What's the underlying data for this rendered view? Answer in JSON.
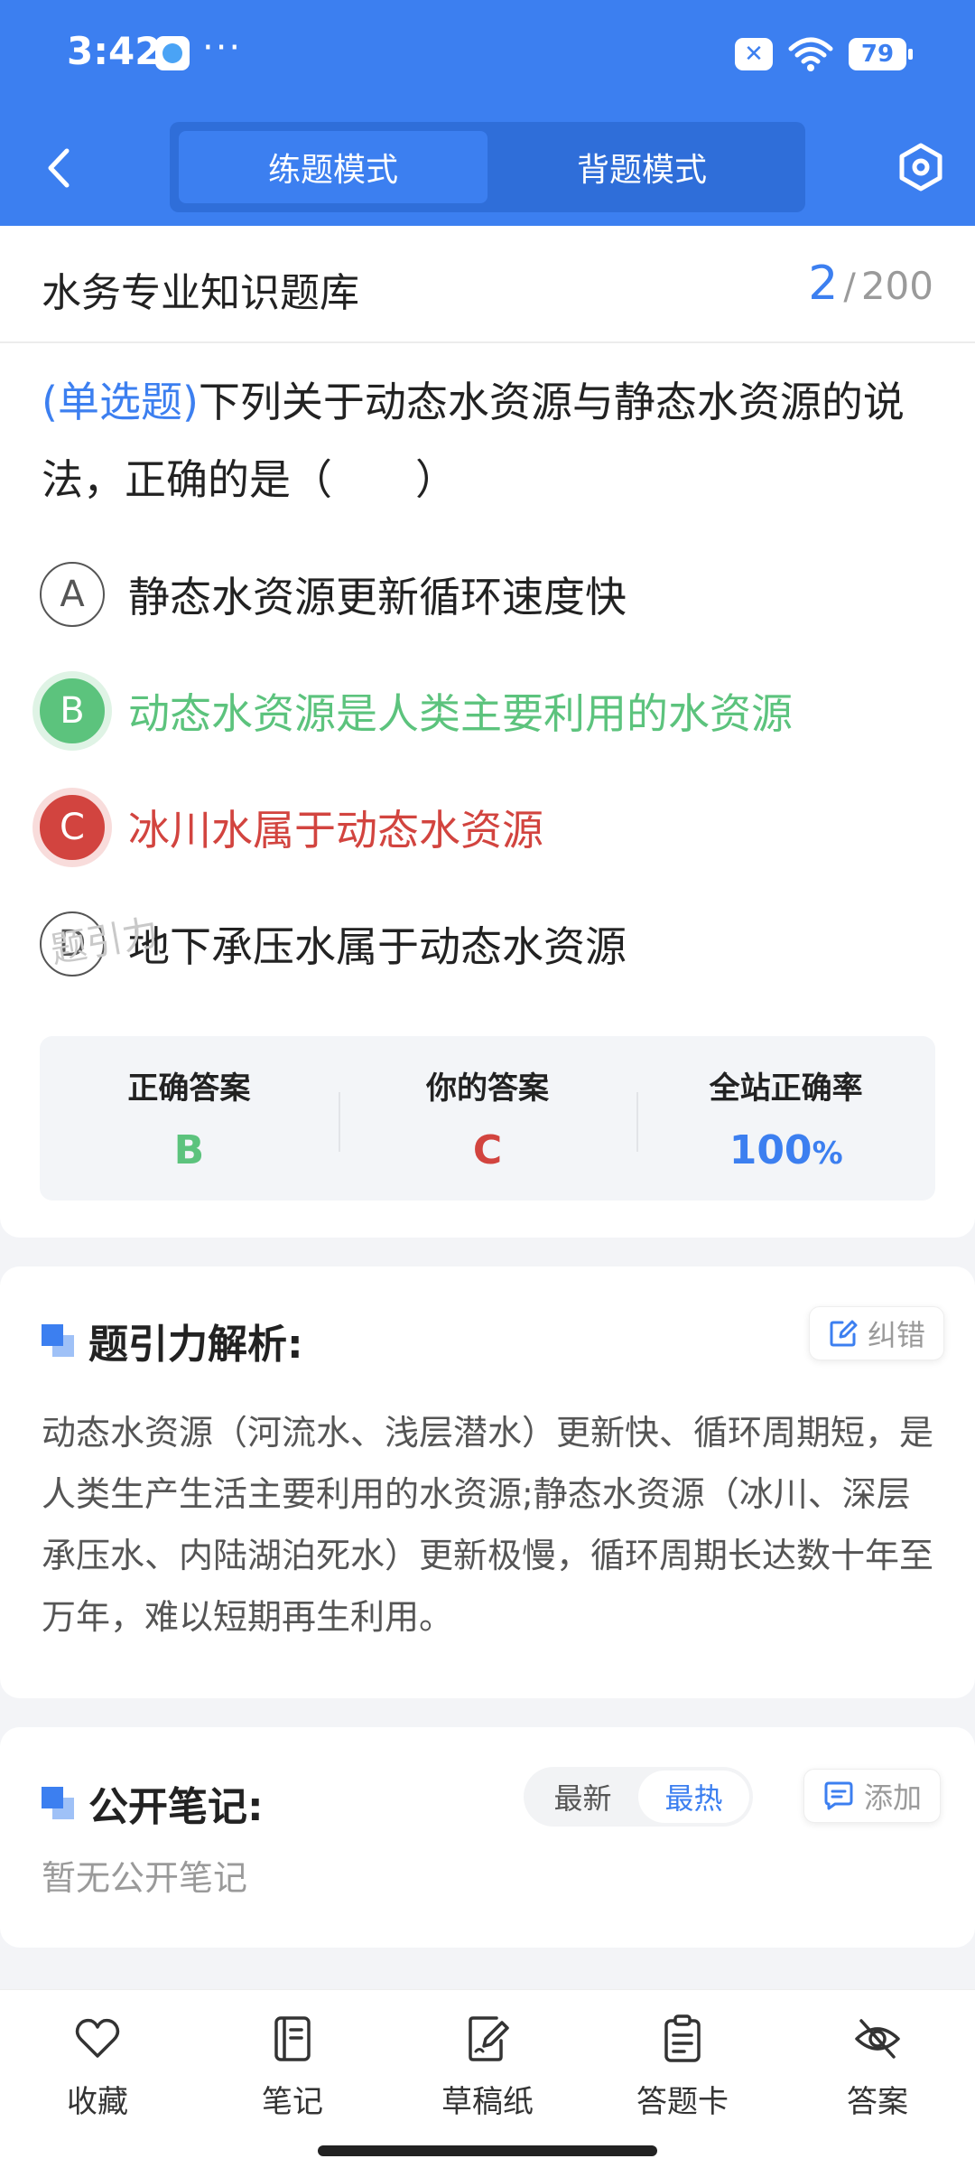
{
  "status_bar": {
    "time": "3:42",
    "dots": "···",
    "battery": "79"
  },
  "header": {
    "tabs": [
      {
        "label": "练题模式",
        "active": true
      },
      {
        "label": "背题模式",
        "active": false
      }
    ]
  },
  "question": {
    "bank_title": "水务专业知识题库",
    "current": "2",
    "separator": "/",
    "total": "200",
    "type_label": "(单选题)",
    "stem": "下列关于动态水资源与静态水资源的说法，正确的是（　　）",
    "options": [
      {
        "letter": "A",
        "text": "静态水资源更新循环速度快",
        "state": "normal"
      },
      {
        "letter": "B",
        "text": "动态水资源是人类主要利用的水资源",
        "state": "correct"
      },
      {
        "letter": "C",
        "text": "冰川水属于动态水资源",
        "state": "wrong"
      },
      {
        "letter": "D",
        "text": "地下承压水属于动态水资源",
        "state": "normal"
      }
    ],
    "result": {
      "correct_label": "正确答案",
      "correct_value": "B",
      "yours_label": "你的答案",
      "yours_value": "C",
      "rate_label": "全站正确率",
      "rate_value": "100",
      "rate_unit": "%"
    },
    "watermark": "题引力"
  },
  "analysis": {
    "title": "题引力解析:",
    "report_label": "纠错",
    "body": "动态水资源（河流水、浅层潜水）更新快、循环周期短，是人类生产生活主要利用的水资源;静态水资源（冰川、深层承压水、内陆湖泊死水）更新极慢，循环周期长达数十年至万年，难以短期再生利用。"
  },
  "notes": {
    "title": "公开笔记:",
    "sort_latest": "最新",
    "sort_hot": "最热",
    "add_label": "添加",
    "empty_text": "暂无公开笔记"
  },
  "bottom_nav": [
    {
      "label": "收藏",
      "icon": "heart-icon"
    },
    {
      "label": "笔记",
      "icon": "notebook-icon"
    },
    {
      "label": "草稿纸",
      "icon": "draft-paper-icon"
    },
    {
      "label": "答题卡",
      "icon": "answer-sheet-icon"
    },
    {
      "label": "答案",
      "icon": "eye-off-icon"
    }
  ],
  "colors": {
    "primary": "#3c7ff0",
    "correct": "#5cc37d",
    "wrong": "#d2443f"
  }
}
